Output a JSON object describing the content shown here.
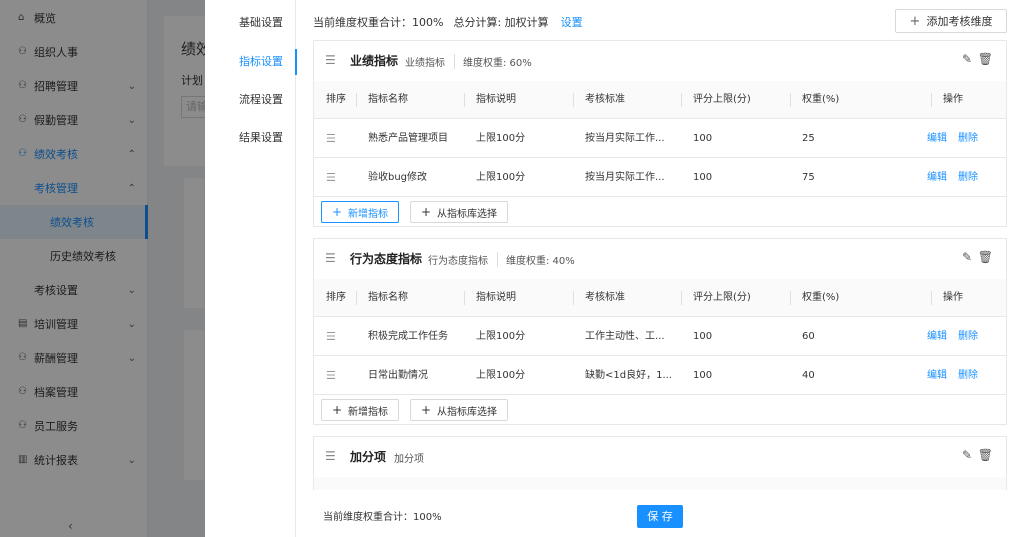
{
  "sidebar": {
    "items": [
      {
        "label": "概览",
        "icon": "home-icon"
      },
      {
        "label": "组织人事",
        "icon": "people-icon"
      },
      {
        "label": "招聘管理",
        "icon": "people-icon"
      },
      {
        "label": "假勤管理",
        "icon": "people-icon"
      },
      {
        "label": "绩效考核",
        "icon": "people-icon"
      },
      {
        "label": "考核管理"
      },
      {
        "label": "绩效考核"
      },
      {
        "label": "历史绩效考核"
      },
      {
        "label": "考核设置"
      },
      {
        "label": "培训管理",
        "icon": "book-icon"
      },
      {
        "label": "薪酬管理",
        "icon": "people-icon"
      },
      {
        "label": "档案管理",
        "icon": "people-icon"
      },
      {
        "label": "员工服务",
        "icon": "people-icon"
      },
      {
        "label": "统计报表",
        "icon": "chart-icon"
      }
    ]
  },
  "background": {
    "title_fragment": "绩效",
    "plan_fragment": "计划",
    "search_fragment": "请输"
  },
  "drawer": {
    "tabs": [
      "基础设置",
      "指标设置",
      "流程设置",
      "结果设置"
    ],
    "summary": {
      "total_weight": "当前维度权重合计：100%",
      "calc": "总分计算: 加权计算",
      "settings_link": "设置"
    },
    "add_dimension_label": "添加考核维度",
    "columns": [
      "排序",
      "指标名称",
      "指标说明",
      "考核标准",
      "评分上限(分)",
      "权重(%)",
      "操作"
    ],
    "dimensions": [
      {
        "name": "业绩指标",
        "desc": "业绩指标",
        "weight": "维度权重: 60%",
        "rows": [
          {
            "name": "熟悉产品管理项目",
            "desc": "上限100分",
            "standard": "按当月实际工作...",
            "max": "100",
            "weight": "25"
          },
          {
            "name": "验收bug修改",
            "desc": "上限100分",
            "standard": "按当月实际工作...",
            "max": "100",
            "weight": "75"
          }
        ]
      },
      {
        "name": "行为态度指标",
        "desc": "行为态度指标",
        "weight": "维度权重: 40%",
        "rows": [
          {
            "name": "积极完成工作任务",
            "desc": "上限100分",
            "standard": "工作主动性、工...",
            "max": "100",
            "weight": "60"
          },
          {
            "name": "日常出勤情况",
            "desc": "上限100分",
            "standard": "缺勤<1d良好，1...",
            "max": "100",
            "weight": "40"
          }
        ]
      },
      {
        "name": "加分项",
        "desc": "加分项",
        "weight": "",
        "rows": []
      }
    ],
    "row_actions": {
      "edit": "编辑",
      "delete": "删除"
    },
    "add_indicator_label": "新增指标",
    "from_library_label": "从指标库选择",
    "footer": {
      "total_weight": "当前维度权重合计：100%",
      "save_label": "保 存"
    }
  },
  "colors": {
    "accent": "#1890ff",
    "mask": "rgba(0,0,0,0.45)"
  }
}
